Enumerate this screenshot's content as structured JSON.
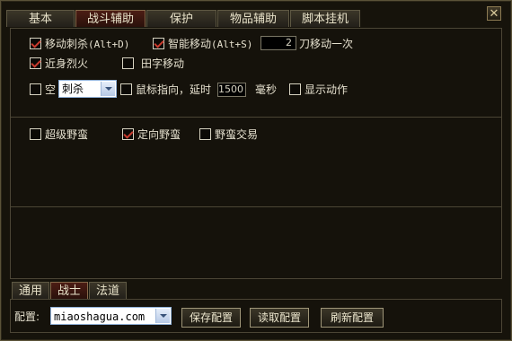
{
  "tabs": [
    "基本",
    "战斗辅助",
    "保护",
    "物品辅助",
    "脚本挂机"
  ],
  "active_tab": "战斗辅助",
  "close_glyph": "✕",
  "row1": {
    "move_kill": {
      "label": "移动刺杀",
      "hotkey": "(Alt+D)",
      "checked": true
    },
    "smart_move": {
      "label": "智能移动",
      "hotkey": "(Alt+S)",
      "checked": true
    },
    "knife_count": "2",
    "knife_suffix": "刀移动一次"
  },
  "row2": {
    "close_fire": {
      "label": "近身烈火",
      "checked": true
    },
    "tian_move": {
      "label": "田字移动",
      "checked": false
    }
  },
  "row3": {
    "empty_skill": {
      "label": "空",
      "checked": false
    },
    "skill_select": "刺杀",
    "mouse_point": {
      "label": "鼠标指向，延时",
      "checked": false
    },
    "delay_value": "1500",
    "delay_unit": "毫秒",
    "show_action": {
      "label": "显示动作",
      "checked": false
    }
  },
  "row4": {
    "super_barbarian": {
      "label": "超级野蛮",
      "checked": false
    },
    "directed_barbarian": {
      "label": "定向野蛮",
      "checked": true
    },
    "barbarian_trade": {
      "label": "野蛮交易",
      "checked": false
    }
  },
  "subtabs": [
    "通用",
    "战士",
    "法道"
  ],
  "active_subtab": "战士",
  "config": {
    "label": "配置:",
    "value": "miaoshagua.com",
    "save": "保存配置",
    "read": "读取配置",
    "refresh": "刷新配置"
  },
  "colors": {
    "check_mark": "#c83b2e",
    "active_tab": "#4c1d14"
  }
}
